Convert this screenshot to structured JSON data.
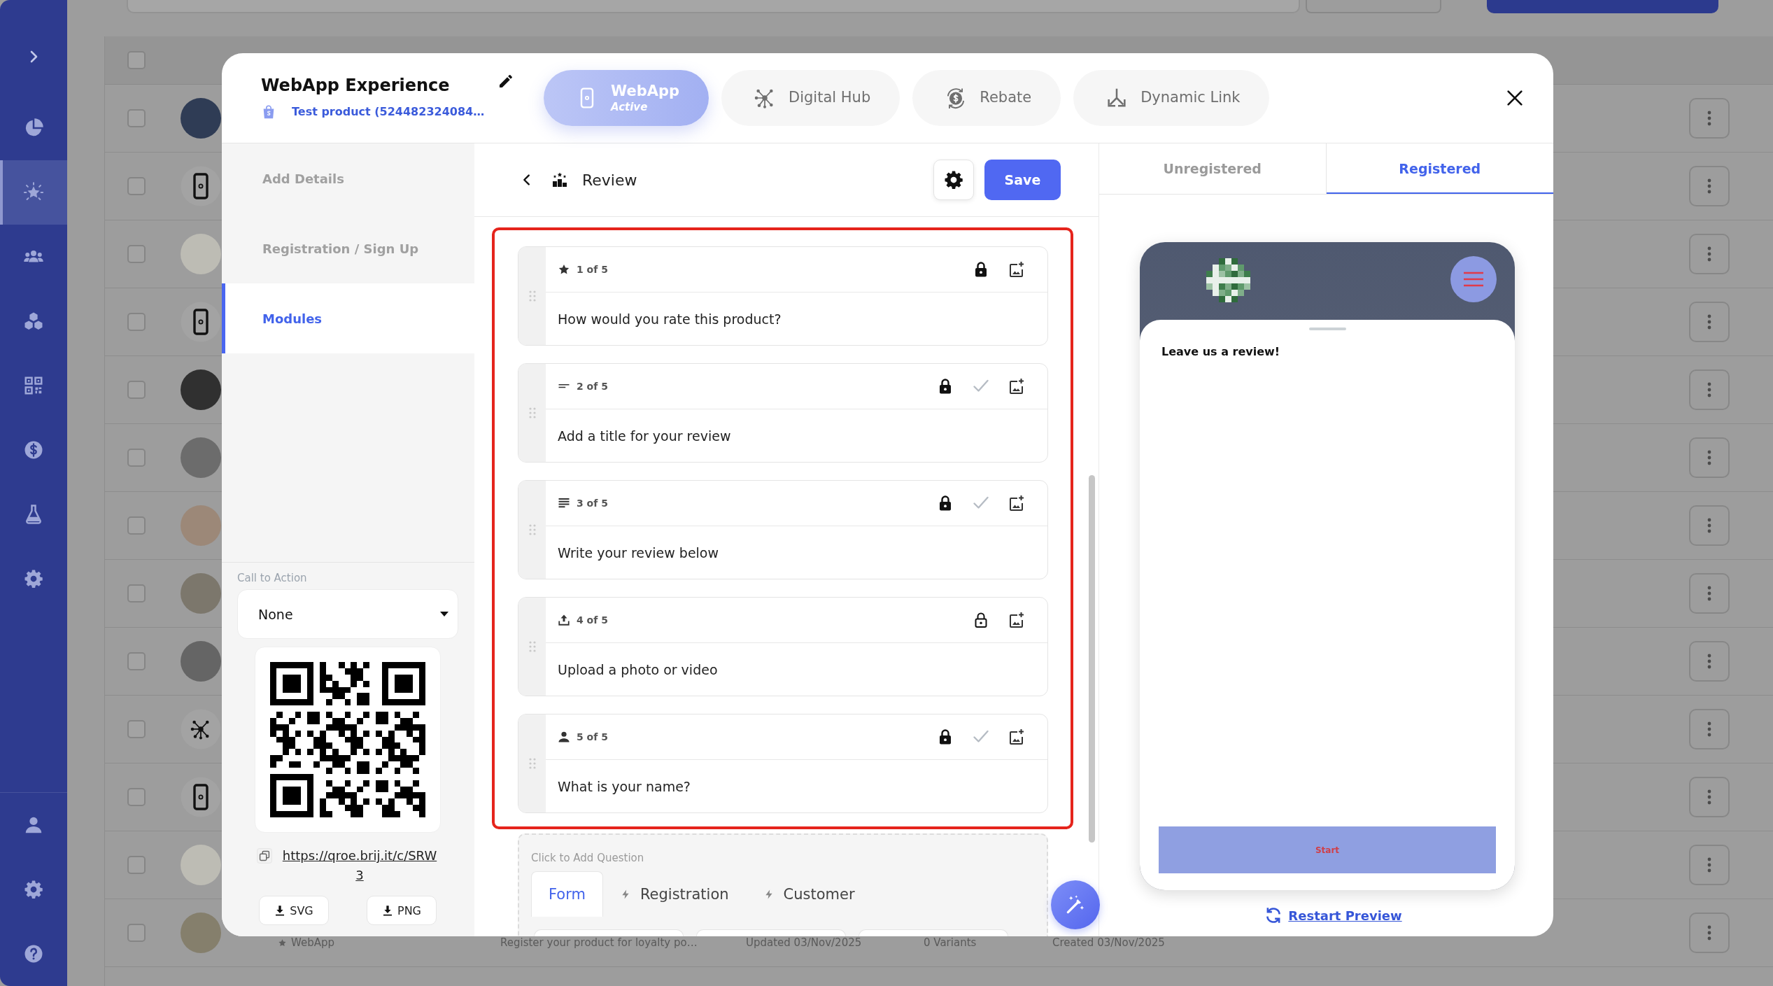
{
  "app_sidebar": {
    "items": [
      {
        "selected": false
      },
      {
        "selected": true
      },
      {
        "selected": false
      },
      {
        "selected": false
      },
      {
        "selected": false
      },
      {
        "selected": false
      },
      {
        "selected": false
      },
      {
        "selected": false
      }
    ]
  },
  "background_table": {
    "header_checkbox": {
      "checked": false
    },
    "rows": [
      {
        "checked": false,
        "kind": "photo"
      },
      {
        "checked": false,
        "kind": "device"
      },
      {
        "checked": false,
        "kind": "photo"
      },
      {
        "checked": false,
        "kind": "device"
      },
      {
        "checked": false,
        "kind": "photo"
      },
      {
        "checked": false,
        "kind": "photo"
      },
      {
        "checked": false,
        "kind": "photo"
      },
      {
        "checked": false,
        "kind": "photo"
      },
      {
        "checked": false,
        "kind": "photo"
      },
      {
        "checked": false,
        "kind": "hub"
      },
      {
        "checked": false,
        "kind": "device"
      },
      {
        "checked": false,
        "kind": "photo"
      },
      {
        "checked": false,
        "kind": "photo",
        "name": "WebApp",
        "description": "Register your product for loyalty po…",
        "updated": "Updated 03/Nov/2025",
        "variants": "0 Variants",
        "created": "Created 03/Nov/2025"
      }
    ]
  },
  "modal": {
    "title": "WebApp Experience",
    "product": "Test product (524482324084…",
    "tabs": [
      {
        "label": "WebApp",
        "status": "Active",
        "selected": true
      },
      {
        "label": "Digital Hub",
        "selected": false
      },
      {
        "label": "Rebate",
        "selected": false
      },
      {
        "label": "Dynamic Link",
        "selected": false
      }
    ],
    "nav": {
      "items": [
        {
          "label": "Add Details",
          "selected": false
        },
        {
          "label": "Registration / Sign Up",
          "selected": false
        },
        {
          "label": "Modules",
          "selected": true
        }
      ]
    },
    "call_to_action": {
      "label": "Call to Action",
      "value": "None"
    },
    "qr": {
      "link": "https://qroe.brij.it/c/SRW3",
      "downloads": [
        "SVG",
        "PNG"
      ]
    },
    "editor": {
      "title": "Review",
      "save": "Save",
      "questions": [
        {
          "kind": "rating",
          "position": "1 of 5",
          "text": "How would you rate this product?",
          "locked": true,
          "checkmark": false
        },
        {
          "kind": "title",
          "position": "2 of 5",
          "text": "Add a title for your review",
          "locked": true,
          "checkmark": true
        },
        {
          "kind": "text",
          "position": "3 of 5",
          "text": "Write your review below",
          "locked": true,
          "checkmark": true
        },
        {
          "kind": "upload",
          "position": "4 of 5",
          "text": "Upload a photo or video",
          "locked": false,
          "checkmark": false
        },
        {
          "kind": "name",
          "position": "5 of 5",
          "text": "What is your name?",
          "locked": true,
          "checkmark": true
        }
      ],
      "add_question": {
        "label": "Click to Add Question",
        "tabs": [
          {
            "label": "Form",
            "kind": "form",
            "selected": true
          },
          {
            "label": "Registration",
            "kind": "linked",
            "selected": false
          },
          {
            "label": "Customer",
            "kind": "linked",
            "selected": false
          }
        ]
      }
    },
    "preview": {
      "tabs": [
        {
          "label": "Unregistered",
          "selected": false
        },
        {
          "label": "Registered",
          "selected": true
        }
      ],
      "heading": "Leave us a review!",
      "start": "Start",
      "restart": "Restart Preview"
    }
  }
}
